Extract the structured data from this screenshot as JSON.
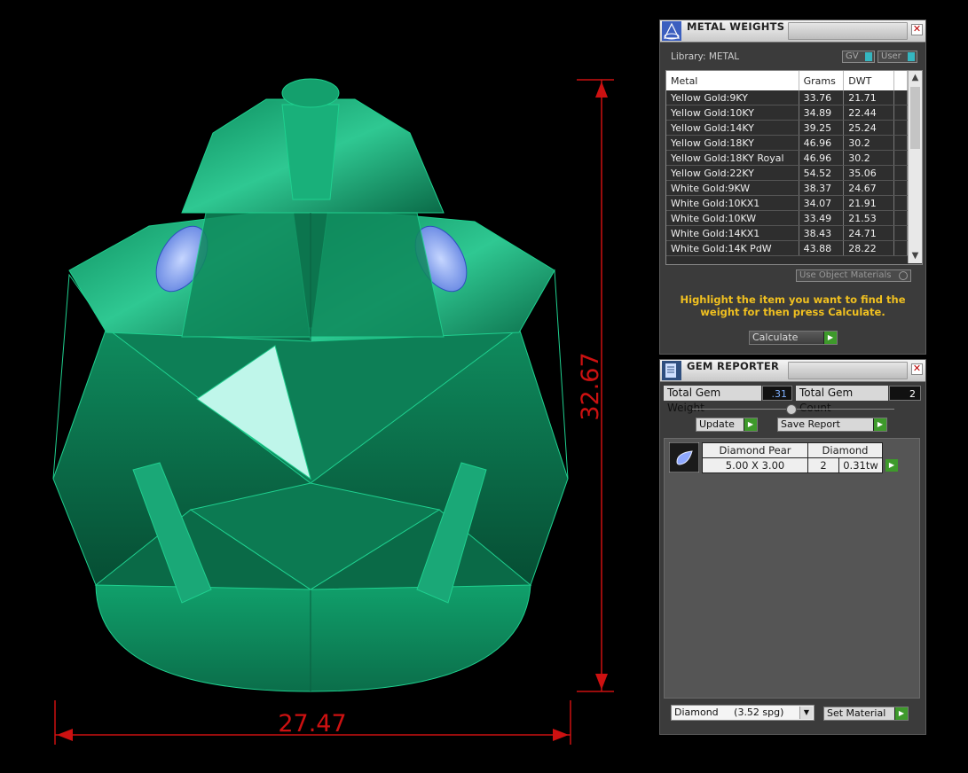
{
  "viewport": {
    "dim_height": "32.67",
    "dim_width": "27.47",
    "dim_color": "#cc1111",
    "model_color": "#0d8a5c",
    "stone_color": "#6f93f2"
  },
  "metal_weights": {
    "title": "METAL WEIGHTS",
    "library": "Library: METAL",
    "toggle_gv": "GV",
    "toggle_user": "User",
    "columns": [
      "Metal",
      "Grams",
      "DWT"
    ],
    "rows": [
      [
        "Yellow Gold:9KY",
        "33.76",
        "21.71"
      ],
      [
        "Yellow Gold:10KY",
        "34.89",
        "22.44"
      ],
      [
        "Yellow Gold:14KY",
        "39.25",
        "25.24"
      ],
      [
        "Yellow Gold:18KY",
        "46.96",
        "30.2"
      ],
      [
        "Yellow Gold:18KY Royal",
        "46.96",
        "30.2"
      ],
      [
        "Yellow Gold:22KY",
        "54.52",
        "35.06"
      ],
      [
        "White Gold:9KW",
        "38.37",
        "24.67"
      ],
      [
        "White Gold:10KX1",
        "34.07",
        "21.91"
      ],
      [
        "White Gold:10KW",
        "33.49",
        "21.53"
      ],
      [
        "White Gold:14KX1",
        "38.43",
        "24.71"
      ],
      [
        "White Gold:14K PdW",
        "43.88",
        "28.22"
      ]
    ],
    "use_object_materials": "Use Object Materials",
    "hint": "Highlight the item you want to find the weight for then press Calculate.",
    "calculate": "Calculate"
  },
  "gem_reporter": {
    "title": "GEM REPORTER",
    "total_weight_label": "Total Gem Weight",
    "total_weight_value": ".31",
    "total_count_label": "Total Gem Count",
    "total_count_value": "2",
    "update": "Update",
    "save_report": "Save Report",
    "report": {
      "shape": "Diamond Pear",
      "material": "Diamond",
      "size": "5.00 X 3.00",
      "count": "2",
      "weight": "0.31tw"
    },
    "material_select": "Diamond     (3.52 spg)",
    "set_material": "Set Material"
  }
}
